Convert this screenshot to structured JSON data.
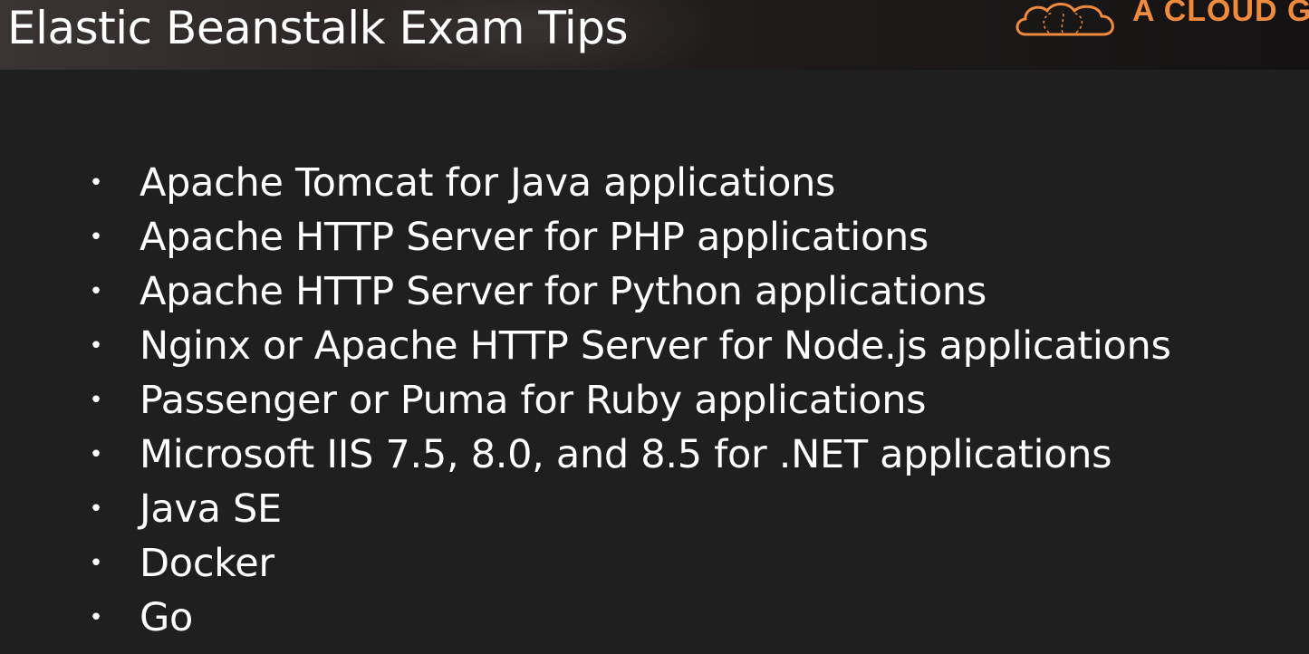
{
  "slide": {
    "title": "Elastic Beanstalk Exam Tips",
    "logo_text": "A CLOUD G",
    "logo_icon": "cloud-logo-icon",
    "bullet_glyph": "•",
    "bullets": [
      "Apache Tomcat for Java applications",
      "Apache HTTP Server for PHP applications",
      "Apache HTTP Server for Python applications",
      "Nginx or Apache HTTP Server for Node.js applications",
      "Passenger or Puma for Ruby applications",
      "Microsoft IIS 7.5, 8.0, and 8.5 for .NET applications",
      "Java SE",
      "Docker",
      "Go"
    ]
  },
  "colors": {
    "background": "#1f1f1f",
    "header": "#2a2424",
    "text": "#ffffff",
    "brand_accent": "#f08a3c"
  }
}
